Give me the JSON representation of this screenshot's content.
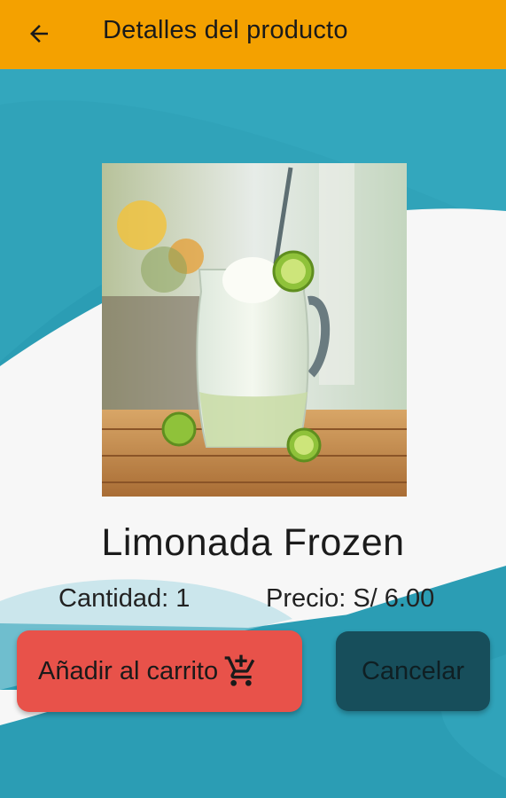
{
  "app_bar": {
    "title": "Detalles del producto",
    "back_icon": "arrow-left-icon",
    "color": "#f4a100"
  },
  "product": {
    "name": "Limonada Frozen",
    "quantity_text": "Cantidad: 1",
    "price_text": "Precio: S/ 6.00",
    "image_subject": "lemonade-pitcher-image"
  },
  "actions": {
    "add_to_cart_label": "Añadir al carrito",
    "add_to_cart_icon": "add-shopping-cart-icon",
    "cancel_label": "Cancelar"
  },
  "colors": {
    "background_teal": "#2b9db4",
    "background_white": "#f7f7f7",
    "add_button": "#e8524a",
    "cancel_button": "#174e5b"
  }
}
